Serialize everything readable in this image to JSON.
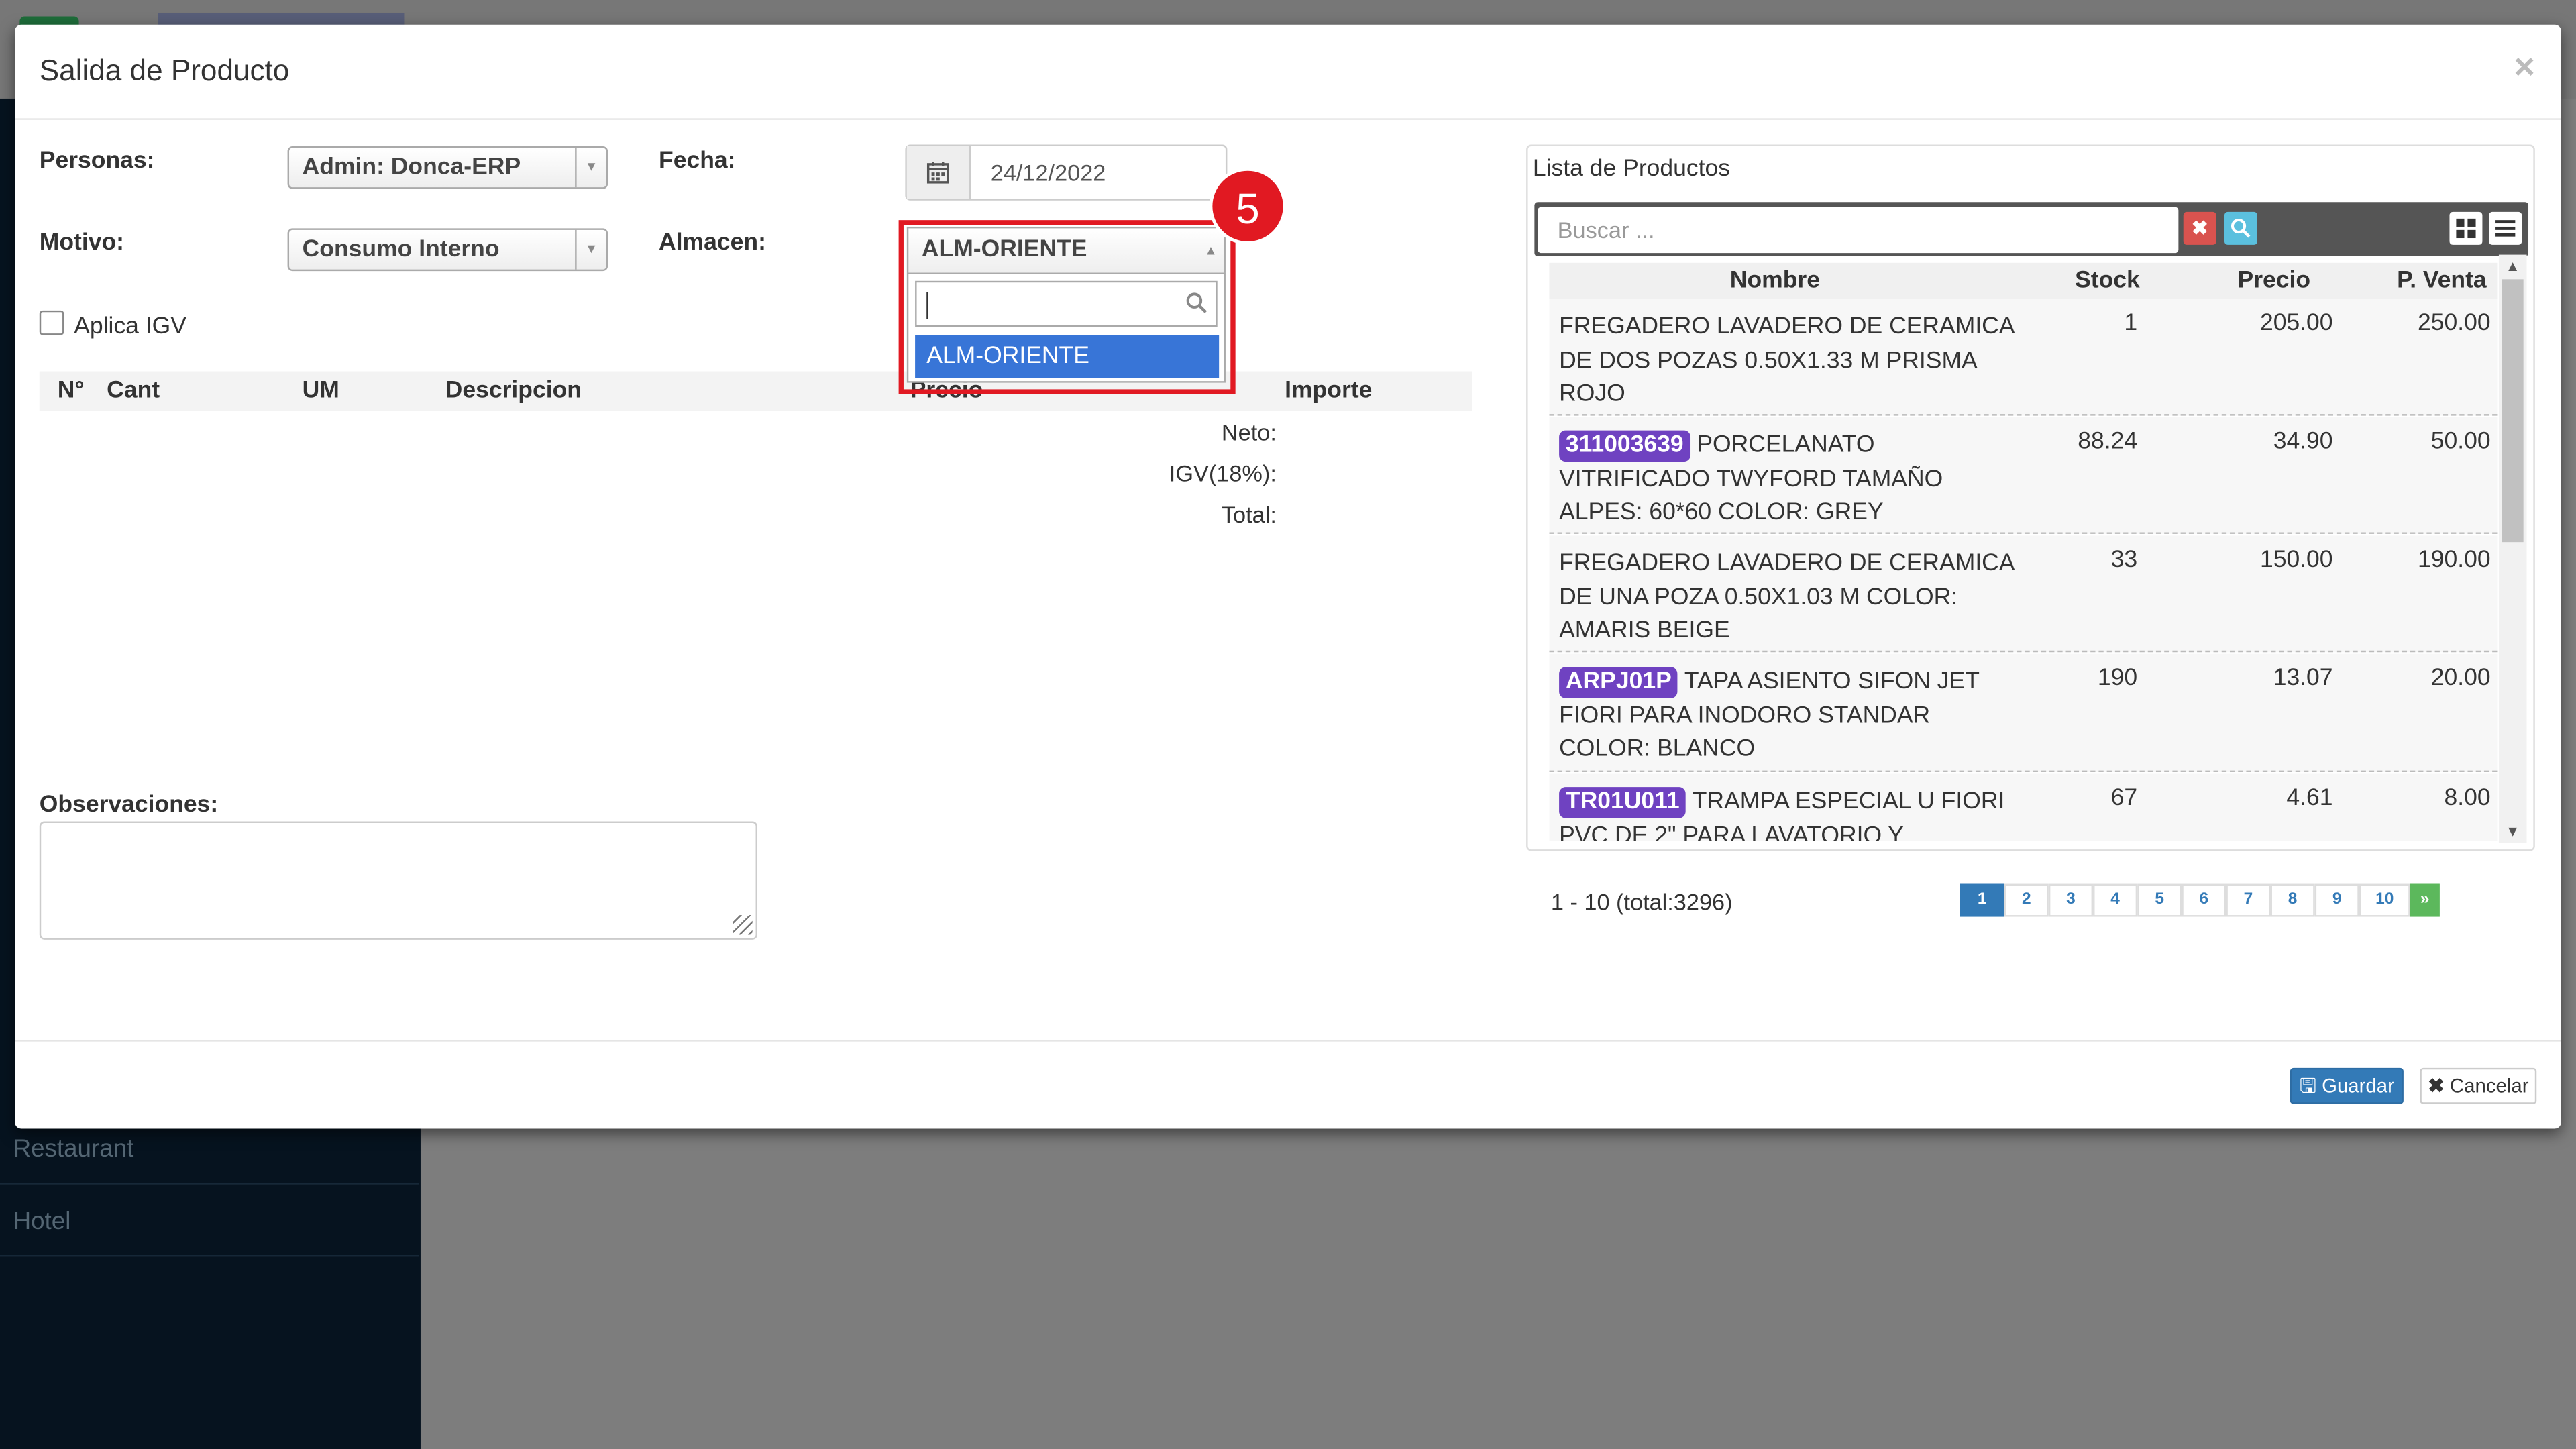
{
  "background": {
    "sidebar_items": [
      "Restaurant",
      "Hotel"
    ]
  },
  "modal": {
    "title": "Salida de Producto",
    "close_glyph": "×",
    "form": {
      "personas_label": "Personas:",
      "personas_value": "Admin: Donca-ERP",
      "fecha_label": "Fecha:",
      "fecha_value": "24/12/2022",
      "motivo_label": "Motivo:",
      "motivo_value": "Consumo Interno",
      "almacen_label": "Almacen:",
      "almacen_value": "ALM-ORIENTE",
      "almacen_options": [
        "ALM-ORIENTE"
      ],
      "aplica_igv_label": "Aplica IGV",
      "aplica_igv_checked": false
    },
    "step_badge": "5",
    "items_table": {
      "headers": [
        "N°",
        "Cant",
        "UM",
        "Descripcion",
        "Precio",
        "Importe"
      ]
    },
    "totals": {
      "neto_label": "Neto:",
      "igv_label": "IGV(18%):",
      "total_label": "Total:"
    },
    "observaciones_label": "Observaciones:",
    "buttons": {
      "save": "Guardar",
      "cancel": "Cancelar"
    }
  },
  "product_list": {
    "title": "Lista de Productos",
    "search_placeholder": "Buscar ...",
    "headers": [
      "Nombre",
      "Stock",
      "Precio",
      "P. Venta"
    ],
    "rows": [
      {
        "code": "",
        "name": "FREGADERO LAVADERO DE CERAMICA DE DOS POZAS 0.50X1.33 M PRISMA ROJO",
        "stock": "1",
        "precio": "205.00",
        "venta": "250.00"
      },
      {
        "code": "311003639",
        "name": "PORCELANATO VITRIFICADO TWYFORD TAMAÑO ALPES: 60*60 COLOR: GREY",
        "stock": "88.24",
        "precio": "34.90",
        "venta": "50.00"
      },
      {
        "code": "",
        "name": "FREGADERO LAVADERO DE CERAMICA DE UNA POZA 0.50X1.03 M COLOR: AMARIS BEIGE",
        "stock": "33",
        "precio": "150.00",
        "venta": "190.00"
      },
      {
        "code": "ARPJ01P",
        "name": "TAPA ASIENTO SIFON JET FIORI PARA INODORO STANDAR COLOR: BLANCO",
        "stock": "190",
        "precio": "13.07",
        "venta": "20.00"
      },
      {
        "code": "TR01U011",
        "name": "TRAMPA ESPECIAL U FIORI PVC DE 2\" PARA LAVATORIO Y",
        "stock": "67",
        "precio": "4.61",
        "venta": "8.00"
      }
    ],
    "pagination": {
      "info": "1 - 10 (total:3296)",
      "pages": [
        "1",
        "2",
        "3",
        "4",
        "5",
        "6",
        "7",
        "8",
        "9",
        "10"
      ],
      "active_page": "1",
      "next": "»"
    }
  }
}
